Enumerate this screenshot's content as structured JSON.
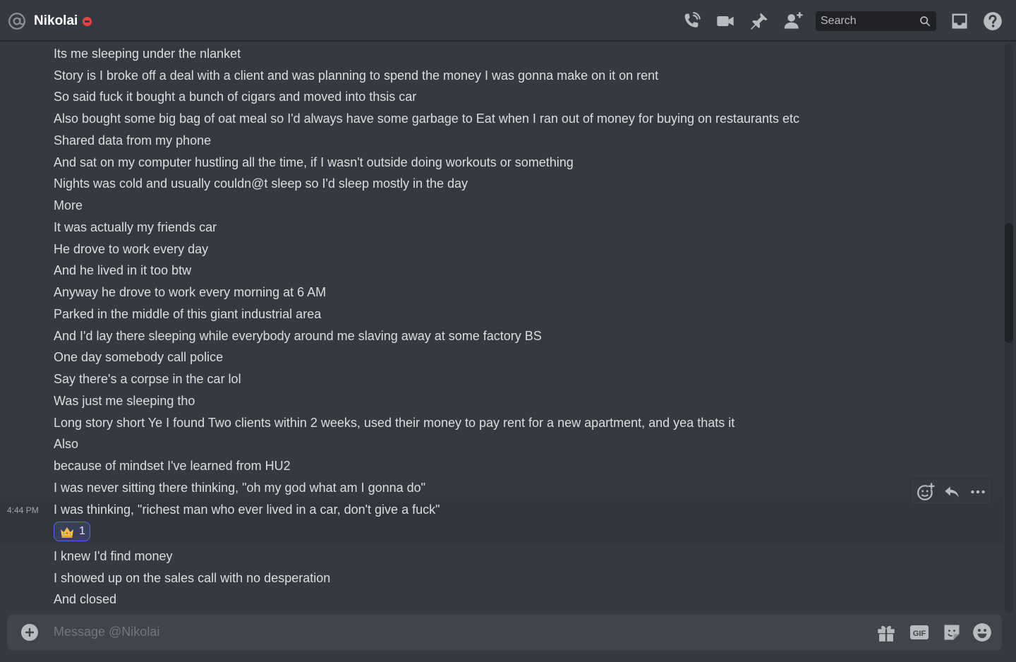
{
  "header": {
    "name": "Nikolai",
    "search_placeholder": "Search"
  },
  "icons": {
    "at": "at-icon",
    "status": "do-not-disturb-status",
    "call": "phone-call-icon",
    "video": "video-camera-icon",
    "pin": "pin-icon",
    "add_friend": "add-friend-icon",
    "search": "search-icon",
    "inbox": "inbox-icon",
    "help": "help-icon"
  },
  "messages": [
    "Its me sleeping under the nlanket",
    "Story is I broke off a deal with a client and was planning to spend the money I was gonna make on it on rent",
    "So said fuck it bought a bunch of cigars and moved into thsis car",
    "Also bought some big bag of oat meal so I'd always have some garbage to Eat when I ran out of money for buying on restaurants etc",
    "Shared data from my phone",
    "And sat on my computer hustling all the time, if I wasn't outside doing workouts or something",
    "Nights was cold and usually couldn@t sleep so I'd sleep mostly in the day",
    "More",
    "It was actually my friends car",
    "He drove to work every day",
    "And he lived in it too btw",
    "Anyway he drove to work every morning at 6 AM",
    "Parked in the middle of this giant industrial area",
    "And I'd lay there sleeping while everybody around me slaving away at some factory BS",
    "One day somebody call police",
    "Say there's a corpse in the car lol",
    "Was just me sleeping tho",
    "Long story short Ye I found Two clients within 2 weeks, used their money to pay rent for a new apartment, and yea thats it",
    "Also",
    "because of mindset I've learned from HU2",
    "I was never sitting there thinking, \"oh my god what am I gonna do\"",
    "I was thinking, \"richest man who ever lived in a car, don't give a fuck\"",
    "I knew I'd find money",
    "I showed up on the sales call with no desperation",
    "And closed"
  ],
  "hovered_message": {
    "timestamp": "4:44 PM",
    "reaction": {
      "emoji": "crown",
      "count": "1"
    }
  },
  "composer": {
    "placeholder": "Message @Nikolai"
  },
  "colors": {
    "background": "#36393f",
    "composer": "#40444b",
    "accent": "#5865f2",
    "dnd": "#ed4245"
  }
}
